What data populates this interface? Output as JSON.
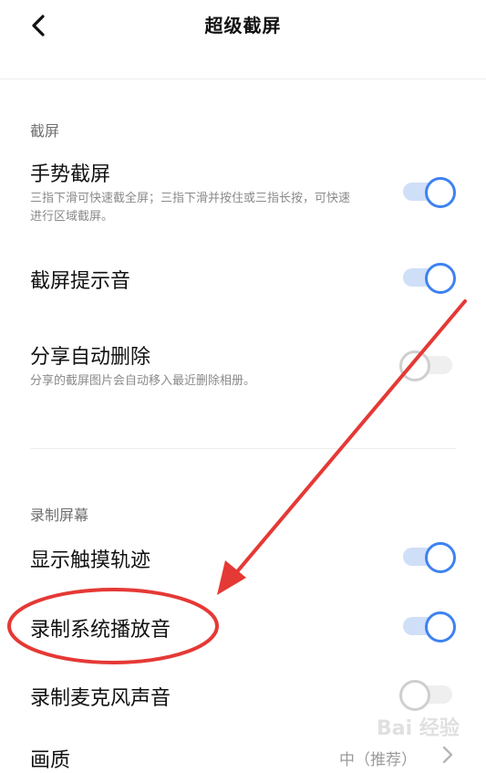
{
  "header": {
    "title": "超级截屏",
    "back_icon": "chevron-left-icon"
  },
  "sections": {
    "screenshot": {
      "title": "截屏",
      "items": [
        {
          "label": "手势截屏",
          "description": "三指下滑可快速截全屏；三指下滑并按住或三指长按，可快速进行区域截屏。",
          "enabled": true
        },
        {
          "label": "截屏提示音",
          "enabled": true
        },
        {
          "label": "分享自动删除",
          "description": "分享的截屏图片会自动移入最近删除相册。",
          "enabled": false
        }
      ]
    },
    "recording": {
      "title": "录制屏幕",
      "items": [
        {
          "label": "显示触摸轨迹",
          "enabled": true
        },
        {
          "label": "录制系统播放音",
          "enabled": true
        },
        {
          "label": "录制麦克风声音",
          "enabled": false
        },
        {
          "label": "画质",
          "value": "中（推荐）"
        }
      ]
    }
  },
  "colors": {
    "accent": "#3e82f0",
    "annotation": "#e53935"
  },
  "watermark": {
    "text": "Bai 经验"
  }
}
